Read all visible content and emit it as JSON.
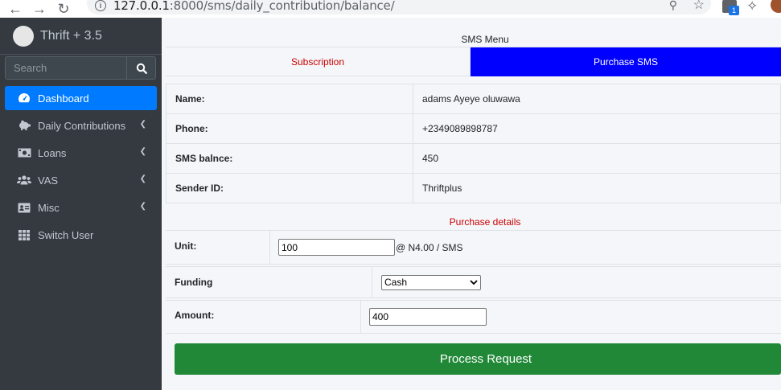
{
  "browser": {
    "url_host": "127.0.0.1",
    "url_path": ":8000/sms/daily_contribution/balance/",
    "extension_badge": "1"
  },
  "sidebar": {
    "brand": "Thrift + 3.5",
    "search_placeholder": "Search",
    "items": [
      {
        "label": "Dashboard",
        "icon": "tachometer-icon",
        "active": true
      },
      {
        "label": "Daily Contributions",
        "icon": "piggy-bank-icon"
      },
      {
        "label": "Loans",
        "icon": "money-bill-icon"
      },
      {
        "label": "VAS",
        "icon": "users-icon"
      },
      {
        "label": "Misc",
        "icon": "id-card-icon"
      },
      {
        "label": "Switch User",
        "icon": "grid-icon"
      }
    ]
  },
  "main": {
    "menu_title": "SMS Menu",
    "tabs": [
      {
        "label": "Subscription"
      },
      {
        "label": "Purchase SMS",
        "active": true
      }
    ],
    "info_rows": [
      {
        "label": "Name:",
        "value": "adams Ayeye oluwawa"
      },
      {
        "label": "Phone:",
        "value": "+2349089898787"
      },
      {
        "label": "SMS balnce:",
        "value": "450"
      },
      {
        "label": "Sender ID:",
        "value": "Thriftplus"
      }
    ],
    "details_title": "Purchase details",
    "unit": {
      "label": "Unit:",
      "value": "100",
      "suffix": "@ N4.00 / SMS"
    },
    "funding": {
      "label": "Funding",
      "value": "Cash"
    },
    "amount": {
      "label": "Amount:",
      "value": "400"
    },
    "process_button": "Process Request"
  },
  "colors": {
    "sidebar_bg": "#343a40",
    "active_item": "#007bff",
    "purchase_tab": "#0000ff",
    "accent_red": "#cc0000",
    "process_button": "#218838"
  }
}
